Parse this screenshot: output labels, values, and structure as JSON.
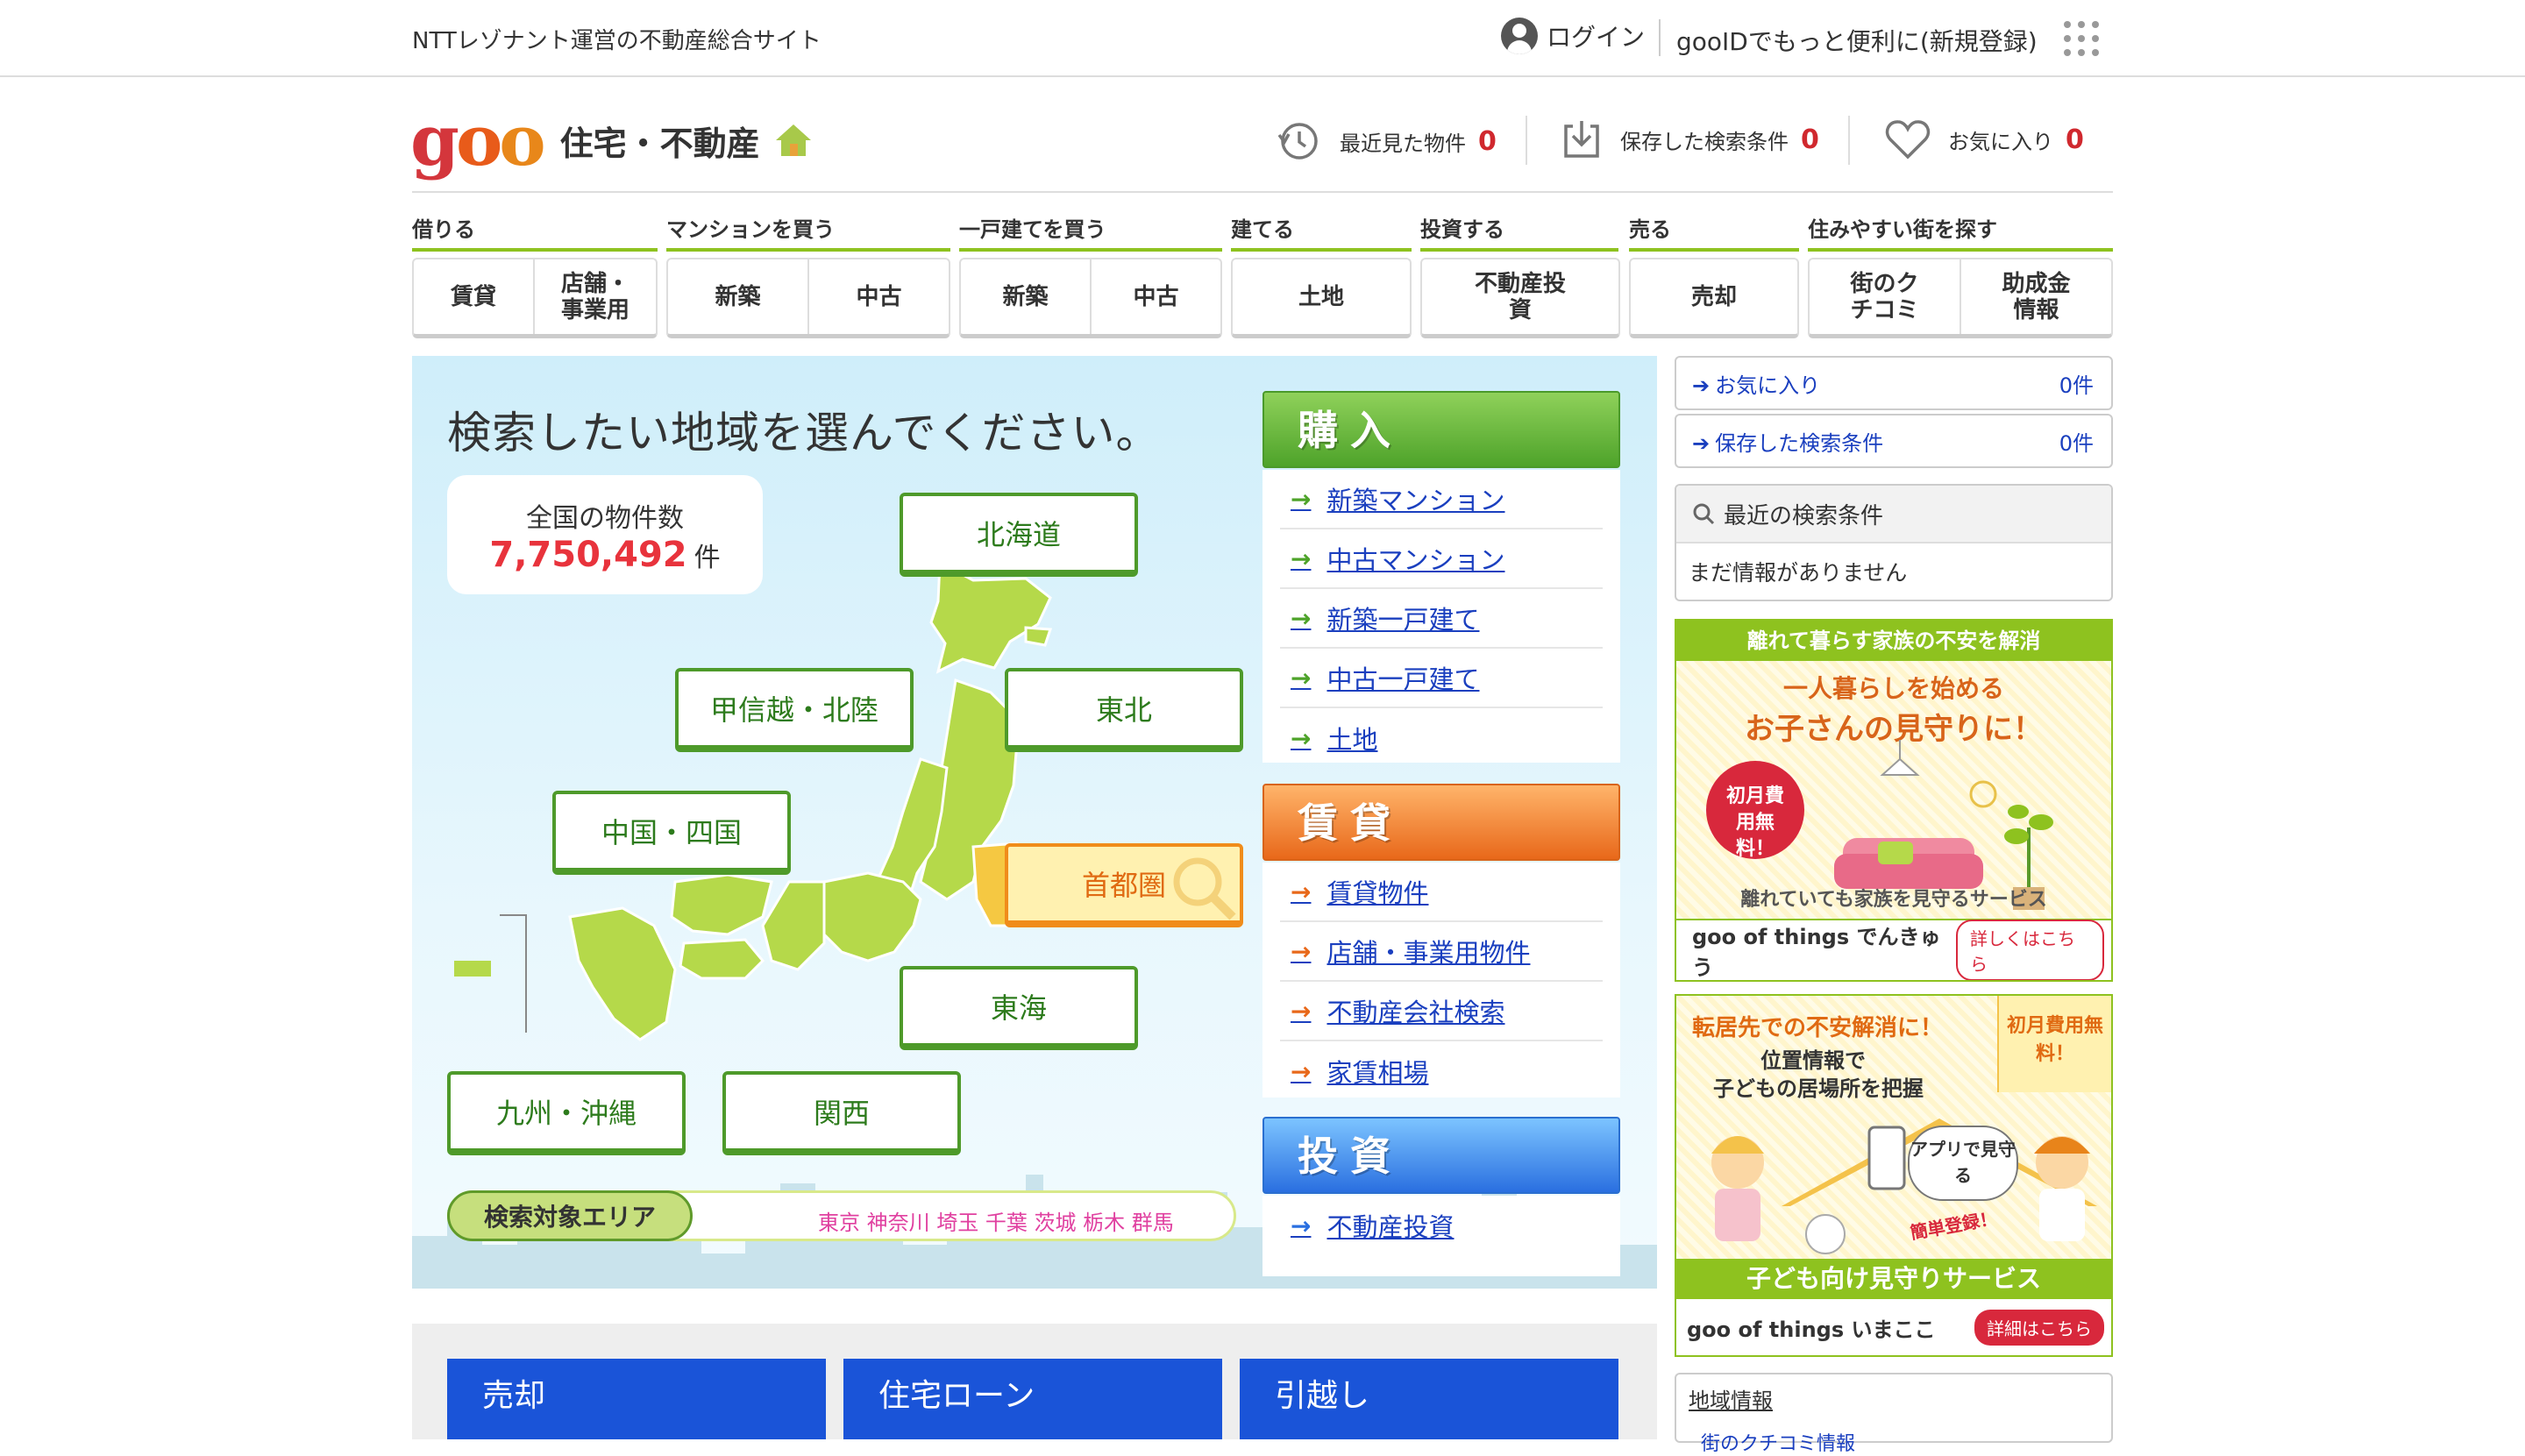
{
  "topbar": {
    "tagline": "NTTレゾナント運営の不動産総合サイト",
    "login": "ログイン",
    "register": "gooIDでもっと便利に(新規登録)"
  },
  "logo": {
    "goo_g": "g",
    "goo_o1": "o",
    "goo_o2": "o",
    "service": "住宅・不動産"
  },
  "header": {
    "recent": {
      "label": "最近見た物件",
      "count": "0"
    },
    "saved": {
      "label": "保存した検索条件",
      "count": "0"
    },
    "favorites": {
      "label": "お気に入り",
      "count": "0"
    }
  },
  "nav": {
    "categories": [
      "借りる",
      "マンションを買う",
      "一戸建てを買う",
      "建てる",
      "投資する",
      "売る",
      "住みやすい街を探す"
    ],
    "buttons": {
      "rent": "賃貸",
      "store": "店舗・事業用",
      "mansion_new": "新築",
      "mansion_used": "中古",
      "house_new": "新築",
      "house_used": "中古",
      "land": "土地",
      "invest": "不動産投資",
      "sell": "売却",
      "town": "街のクチコミ",
      "subsidy": "助成金情報"
    }
  },
  "map": {
    "title": "検索したい地域を選んでください。",
    "count_label": "全国の物件数",
    "count_value": "7,750,492",
    "count_unit": "件",
    "regions": {
      "hokkaido": "北海道",
      "koshinetsu": "甲信越・北陸",
      "tohoku": "東北",
      "chugoku": "中国・四国",
      "shutoken": "首都圏",
      "tokai": "東海",
      "kyushu": "九州・沖縄",
      "kansai": "関西"
    },
    "area_label": "検索対象エリア",
    "area_list": "東京 神奈川 埼玉 千葉 茨城 栃木 群馬"
  },
  "purchase": {
    "heading": "購入",
    "items": [
      "新築マンション",
      "中古マンション",
      "新築一戸建て",
      "中古一戸建て",
      "土地"
    ]
  },
  "rental": {
    "heading": "賃貸",
    "items": [
      "賃貸物件",
      "店舗・事業用物件",
      "不動産会社検索",
      "家賃相場"
    ]
  },
  "investment": {
    "heading": "投資",
    "items": [
      "不動産投資"
    ]
  },
  "right": {
    "favorites": {
      "label": "お気に入り",
      "count": "0件"
    },
    "saved": {
      "label": "保存した検索条件",
      "count": "0件"
    },
    "recent_title": "最近の検索条件",
    "recent_empty": "まだ情報がありません",
    "banner1": {
      "top": "離れて暮らす家族の不安を解消",
      "line1": "一人暮らしを始める",
      "line2": "お子さんの見守りに！",
      "badge": "初月費用無料！",
      "sub": "離れていても家族を見守るサービス",
      "brand": "goo of things でんきゅう",
      "cta": "詳しくはこちら"
    },
    "banner2": {
      "line1": "転居先での不安解消に！",
      "line2": "位置情報で",
      "line3": "子どもの居場所を把握",
      "badge": "初月費用無料！",
      "bubble": "アプリで見守る",
      "easy": "簡単登録！",
      "sub": "子ども向け見守りサービス",
      "brand": "goo of things いまここ",
      "cta": "詳細はこちら"
    },
    "region_info": "地域情報",
    "region_info_sub": "街のクチコミ情報"
  },
  "bottom": {
    "tiles": [
      "売却",
      "住宅ローン",
      "引越し"
    ]
  },
  "colors": {
    "accent_green": "#8ec21f",
    "brand_red": "#d4363c",
    "link_blue": "#1a3fbf",
    "tile_blue": "#1a54d8"
  }
}
